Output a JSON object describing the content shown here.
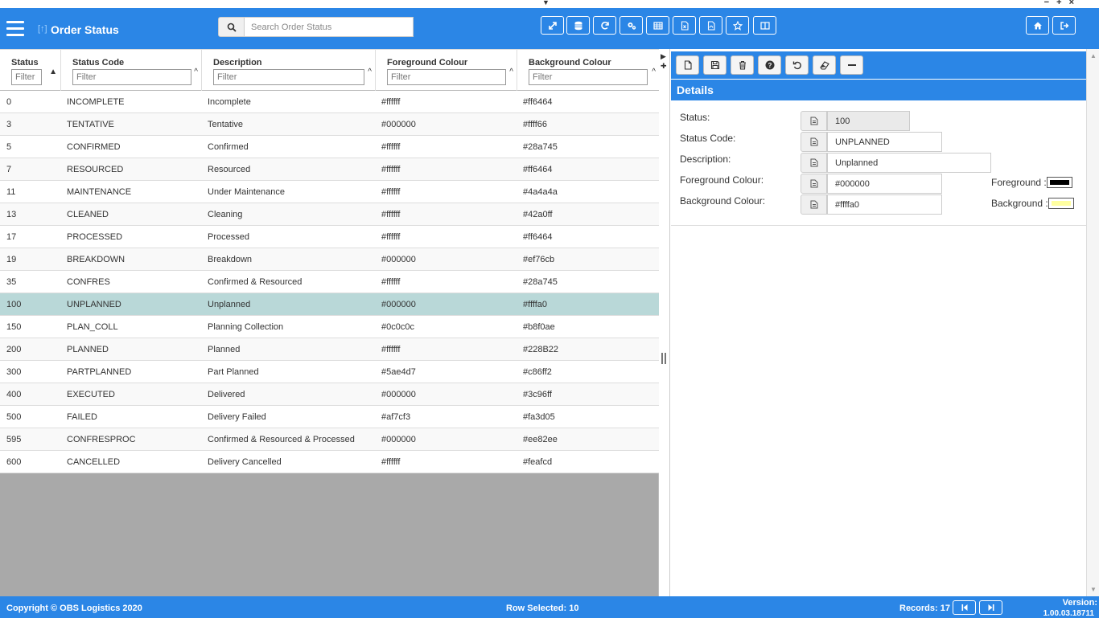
{
  "app": {
    "title": "Order Status",
    "search_placeholder": "Search Order Status"
  },
  "grid": {
    "columns": [
      {
        "label": "Status",
        "filter_placeholder": "Filter"
      },
      {
        "label": "Status Code",
        "filter_placeholder": "Filter"
      },
      {
        "label": "Description",
        "filter_placeholder": "Filter"
      },
      {
        "label": "Foreground Colour",
        "filter_placeholder": "Filter"
      },
      {
        "label": "Background Colour",
        "filter_placeholder": "Filter"
      }
    ],
    "rows": [
      {
        "status": "0",
        "code": "INCOMPLETE",
        "desc": "Incomplete",
        "fg": "#ffffff",
        "bg": "#ff6464"
      },
      {
        "status": "3",
        "code": "TENTATIVE",
        "desc": "Tentative",
        "fg": "#000000",
        "bg": "#ffff66"
      },
      {
        "status": "5",
        "code": "CONFIRMED",
        "desc": "Confirmed",
        "fg": "#ffffff",
        "bg": "#28a745"
      },
      {
        "status": "7",
        "code": "RESOURCED",
        "desc": "Resourced",
        "fg": "#ffffff",
        "bg": "#ff6464"
      },
      {
        "status": "11",
        "code": "MAINTENANCE",
        "desc": "Under Maintenance",
        "fg": "#ffffff",
        "bg": "#4a4a4a"
      },
      {
        "status": "13",
        "code": "CLEANED",
        "desc": "Cleaning",
        "fg": "#ffffff",
        "bg": "#42a0ff"
      },
      {
        "status": "17",
        "code": "PROCESSED",
        "desc": "Processed",
        "fg": "#ffffff",
        "bg": "#ff6464"
      },
      {
        "status": "19",
        "code": "BREAKDOWN",
        "desc": "Breakdown",
        "fg": "#000000",
        "bg": "#ef76cb"
      },
      {
        "status": "35",
        "code": "CONFRES",
        "desc": "Confirmed & Resourced",
        "fg": "#ffffff",
        "bg": "#28a745"
      },
      {
        "status": "100",
        "code": "UNPLANNED",
        "desc": "Unplanned",
        "fg": "#000000",
        "bg": "#ffffa0"
      },
      {
        "status": "150",
        "code": "PLAN_COLL",
        "desc": "Planning Collection",
        "fg": "#0c0c0c",
        "bg": "#b8f0ae"
      },
      {
        "status": "200",
        "code": "PLANNED",
        "desc": "Planned",
        "fg": "#ffffff",
        "bg": "#228B22"
      },
      {
        "status": "300",
        "code": "PARTPLANNED",
        "desc": "Part Planned",
        "fg": "#5ae4d7",
        "bg": "#c86ff2"
      },
      {
        "status": "400",
        "code": "EXECUTED",
        "desc": "Delivered",
        "fg": "#000000",
        "bg": "#3c96ff"
      },
      {
        "status": "500",
        "code": "FAILED",
        "desc": "Delivery Failed",
        "fg": "#af7cf3",
        "bg": "#fa3d05"
      },
      {
        "status": "595",
        "code": "CONFRESPROC",
        "desc": "Confirmed & Resourced & Processed",
        "fg": "#000000",
        "bg": "#ee82ee"
      },
      {
        "status": "600",
        "code": "CANCELLED",
        "desc": "Delivery Cancelled",
        "fg": "#ffffff",
        "bg": "#feafcd"
      }
    ],
    "selected_index": 9
  },
  "details": {
    "title": "Details",
    "status_label": "Status:",
    "status_value": "100",
    "code_label": "Status Code:",
    "code_value": "UNPLANNED",
    "desc_label": "Description:",
    "desc_value": "Unplanned",
    "fg_label": "Foreground Colour:",
    "fg_value": "#000000",
    "bg_label": "Background Colour:",
    "bg_value": "#ffffa0",
    "fg_swatch_label": "Foreground :",
    "bg_swatch_label": "Background :",
    "fg_swatch_color": "#000000",
    "bg_swatch_color": "#ffffa0"
  },
  "footer": {
    "copyright": "Copyright © OBS Logistics 2020",
    "row_selected": "Row Selected: 10",
    "records": "Records: 17",
    "version_label": "Version:",
    "version_value": "1.00.03.18711"
  },
  "colors": {
    "accent": "#2b86e6",
    "selected_row": "#b9d8d8"
  }
}
